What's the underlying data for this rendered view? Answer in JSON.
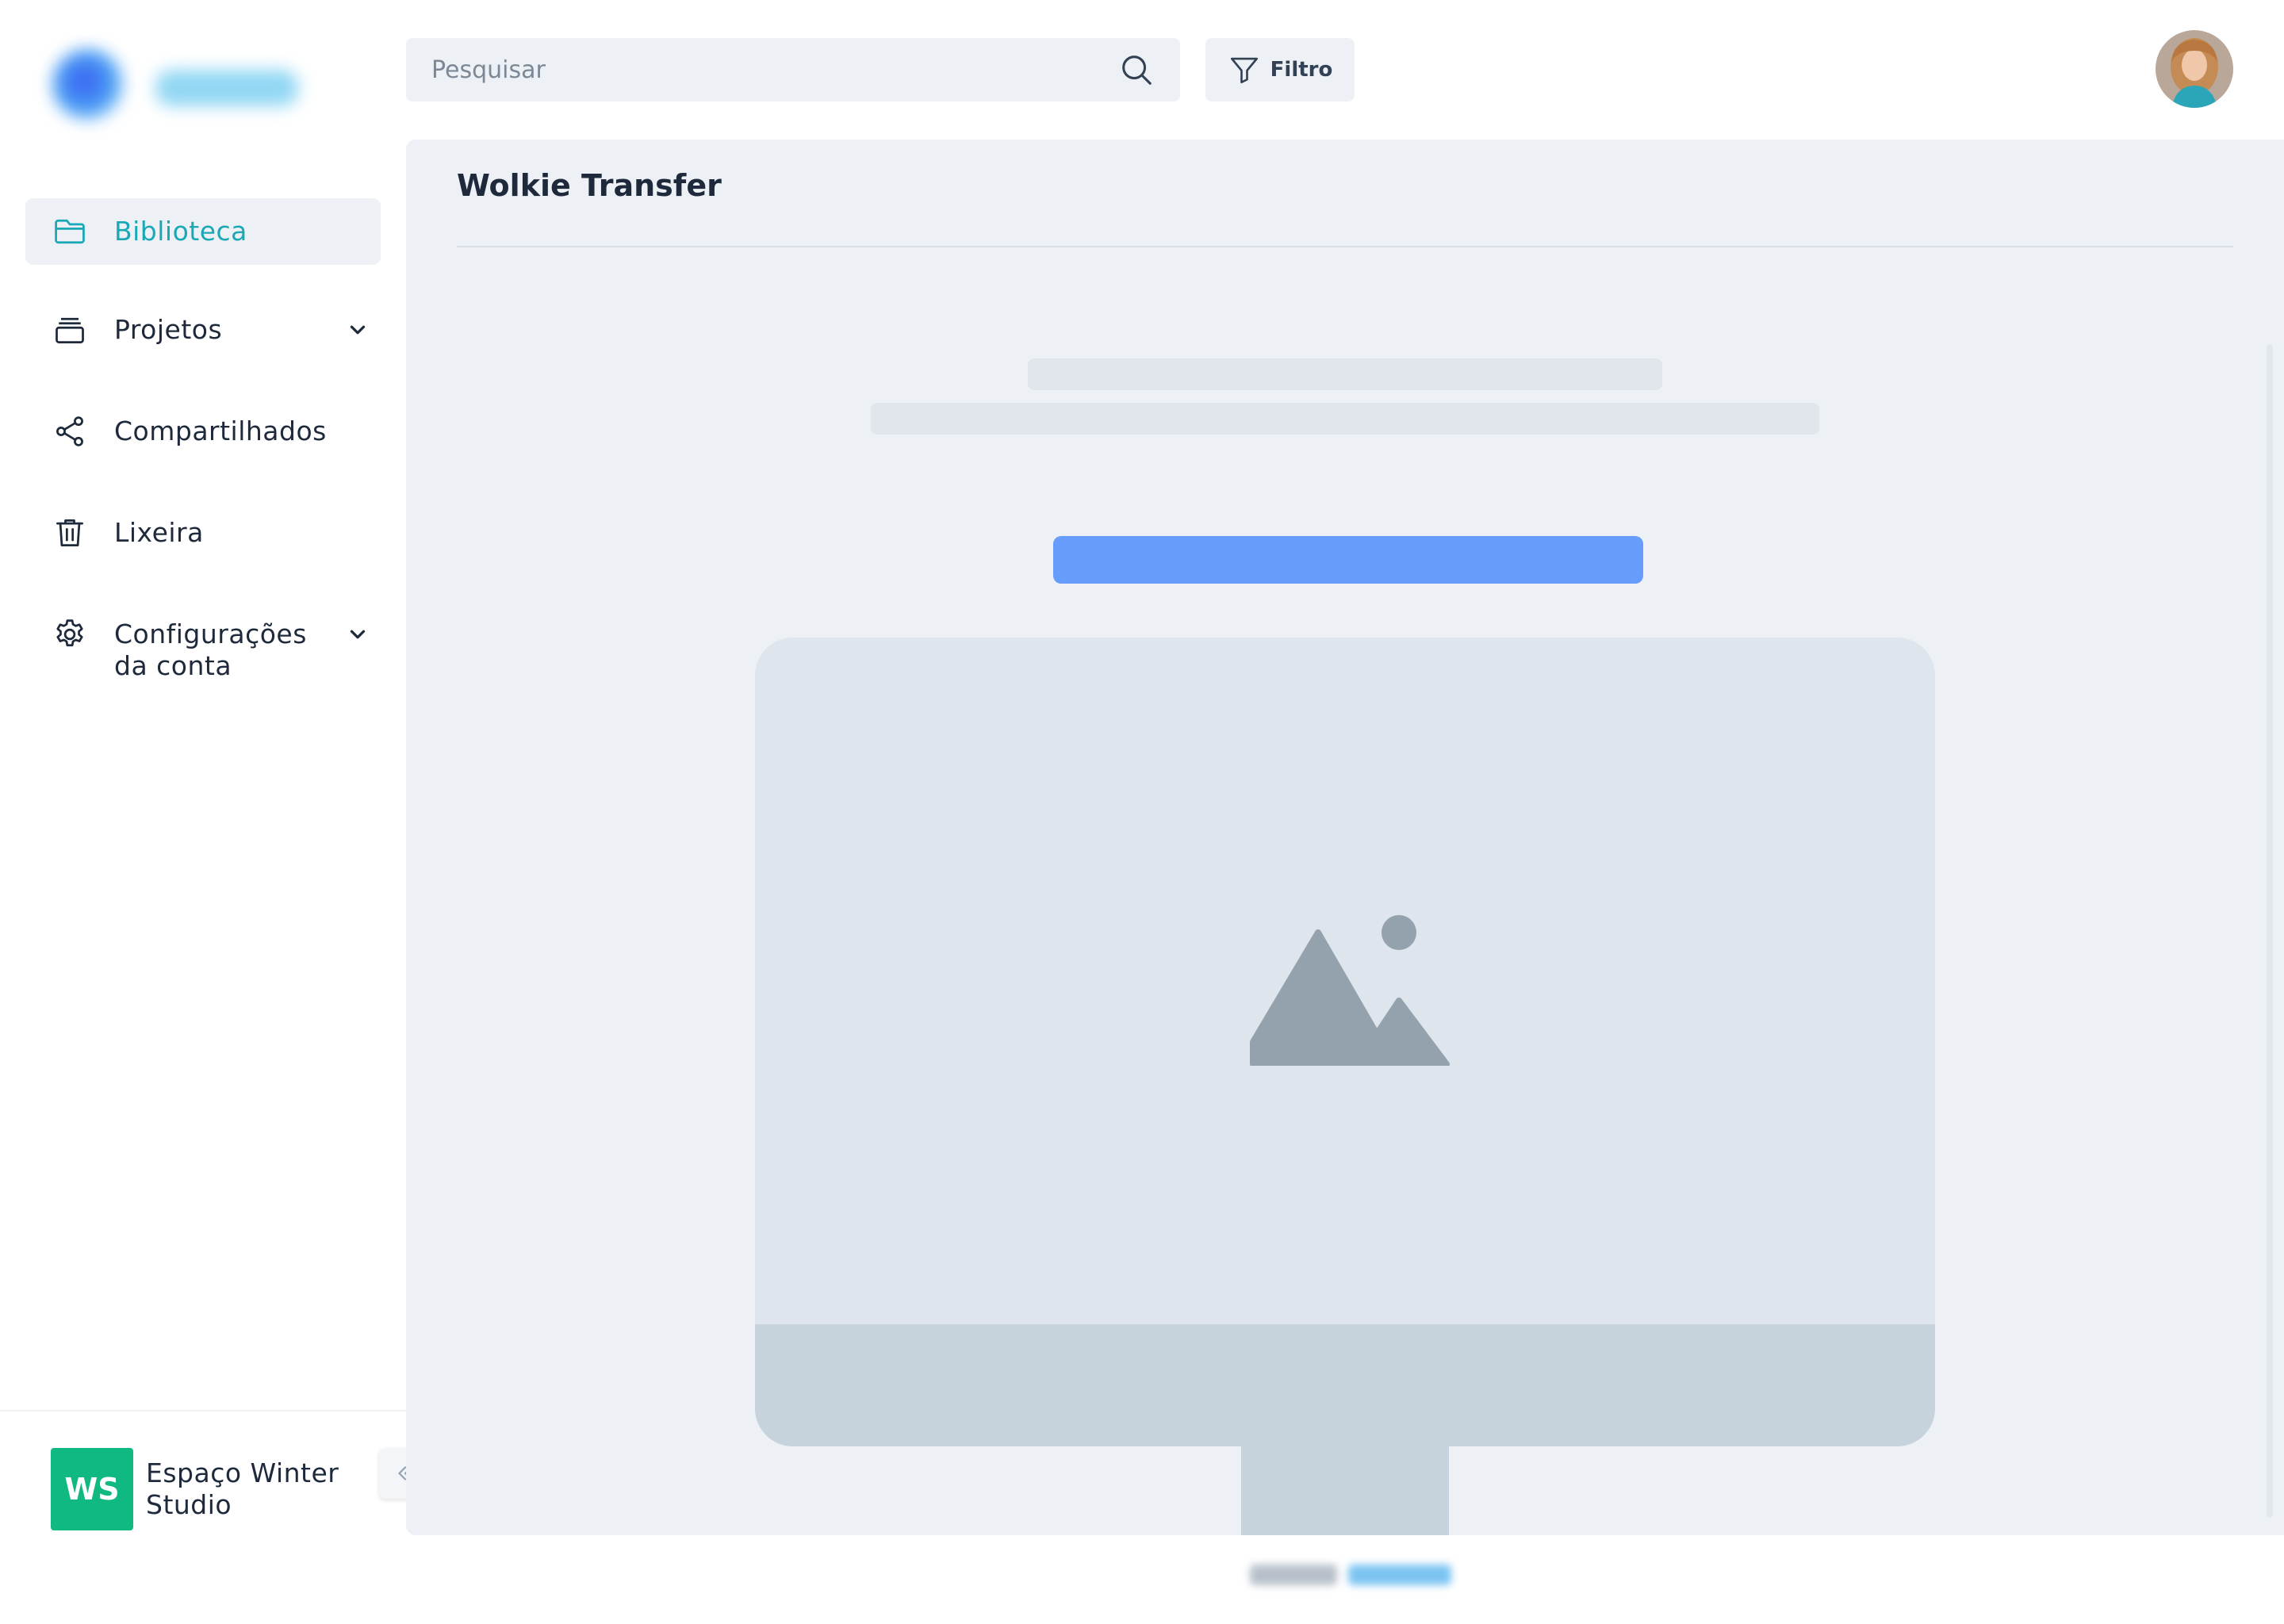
{
  "colors": {
    "accent": "#1aa7b6",
    "primary_button": "#669dfd",
    "workspace_badge": "#10b981",
    "panel_bg": "#edf1f5"
  },
  "header": {
    "search_placeholder": "Pesquisar",
    "filter_label": "Filtro"
  },
  "sidebar": {
    "items": [
      {
        "label": "Biblioteca",
        "icon": "folder-icon",
        "active": true
      },
      {
        "label": "Projetos",
        "icon": "archive-icon",
        "has_submenu": true
      },
      {
        "label": "Compartilhados",
        "icon": "share-icon"
      },
      {
        "label": "Lixeira",
        "icon": "trash-icon"
      },
      {
        "label_line1": "Configurações",
        "label_line2": "da conta",
        "icon": "gear-icon",
        "has_submenu": true
      }
    ],
    "workspace": {
      "initials": "WS",
      "name_line1": "Espaço Winter",
      "name_line2": "Studio"
    }
  },
  "main": {
    "title": "Wolkie Transfer",
    "placeholder_icon": "image-icon"
  }
}
